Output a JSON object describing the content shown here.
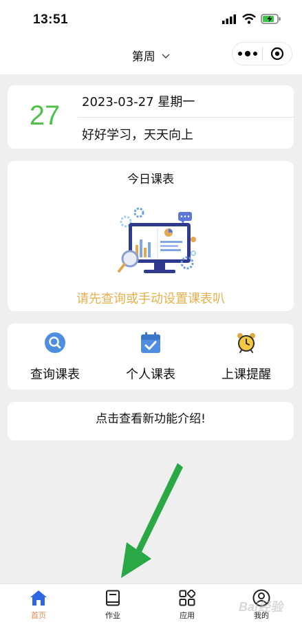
{
  "status_bar": {
    "time": "13:51"
  },
  "nav": {
    "title": "第周"
  },
  "date_card": {
    "day": "27",
    "date": "2023-03-27 星期一",
    "motto": "好好学习，天天向上"
  },
  "schedule": {
    "title": "今日课表",
    "hint": "请先查询或手动设置课表叭"
  },
  "actions": {
    "query": "查询课表",
    "personal": "个人课表",
    "reminder": "上课提醒"
  },
  "intro": {
    "text": "点击查看新功能介绍!"
  },
  "tabs": [
    {
      "label": "首页",
      "icon": "home-icon",
      "active": true
    },
    {
      "label": "作业",
      "icon": "book-icon",
      "active": false
    },
    {
      "label": "应用",
      "icon": "apps-icon",
      "active": false
    },
    {
      "label": "我的",
      "icon": "profile-icon",
      "active": false
    }
  ],
  "watermark": "Bai经验",
  "colors": {
    "accent_green": "#4fc14a",
    "hint_orange": "#e7b04c",
    "tab_active": "#e38a4a",
    "tab_icon_active": "#2f66e6",
    "arrow_green": "#2aa845"
  }
}
